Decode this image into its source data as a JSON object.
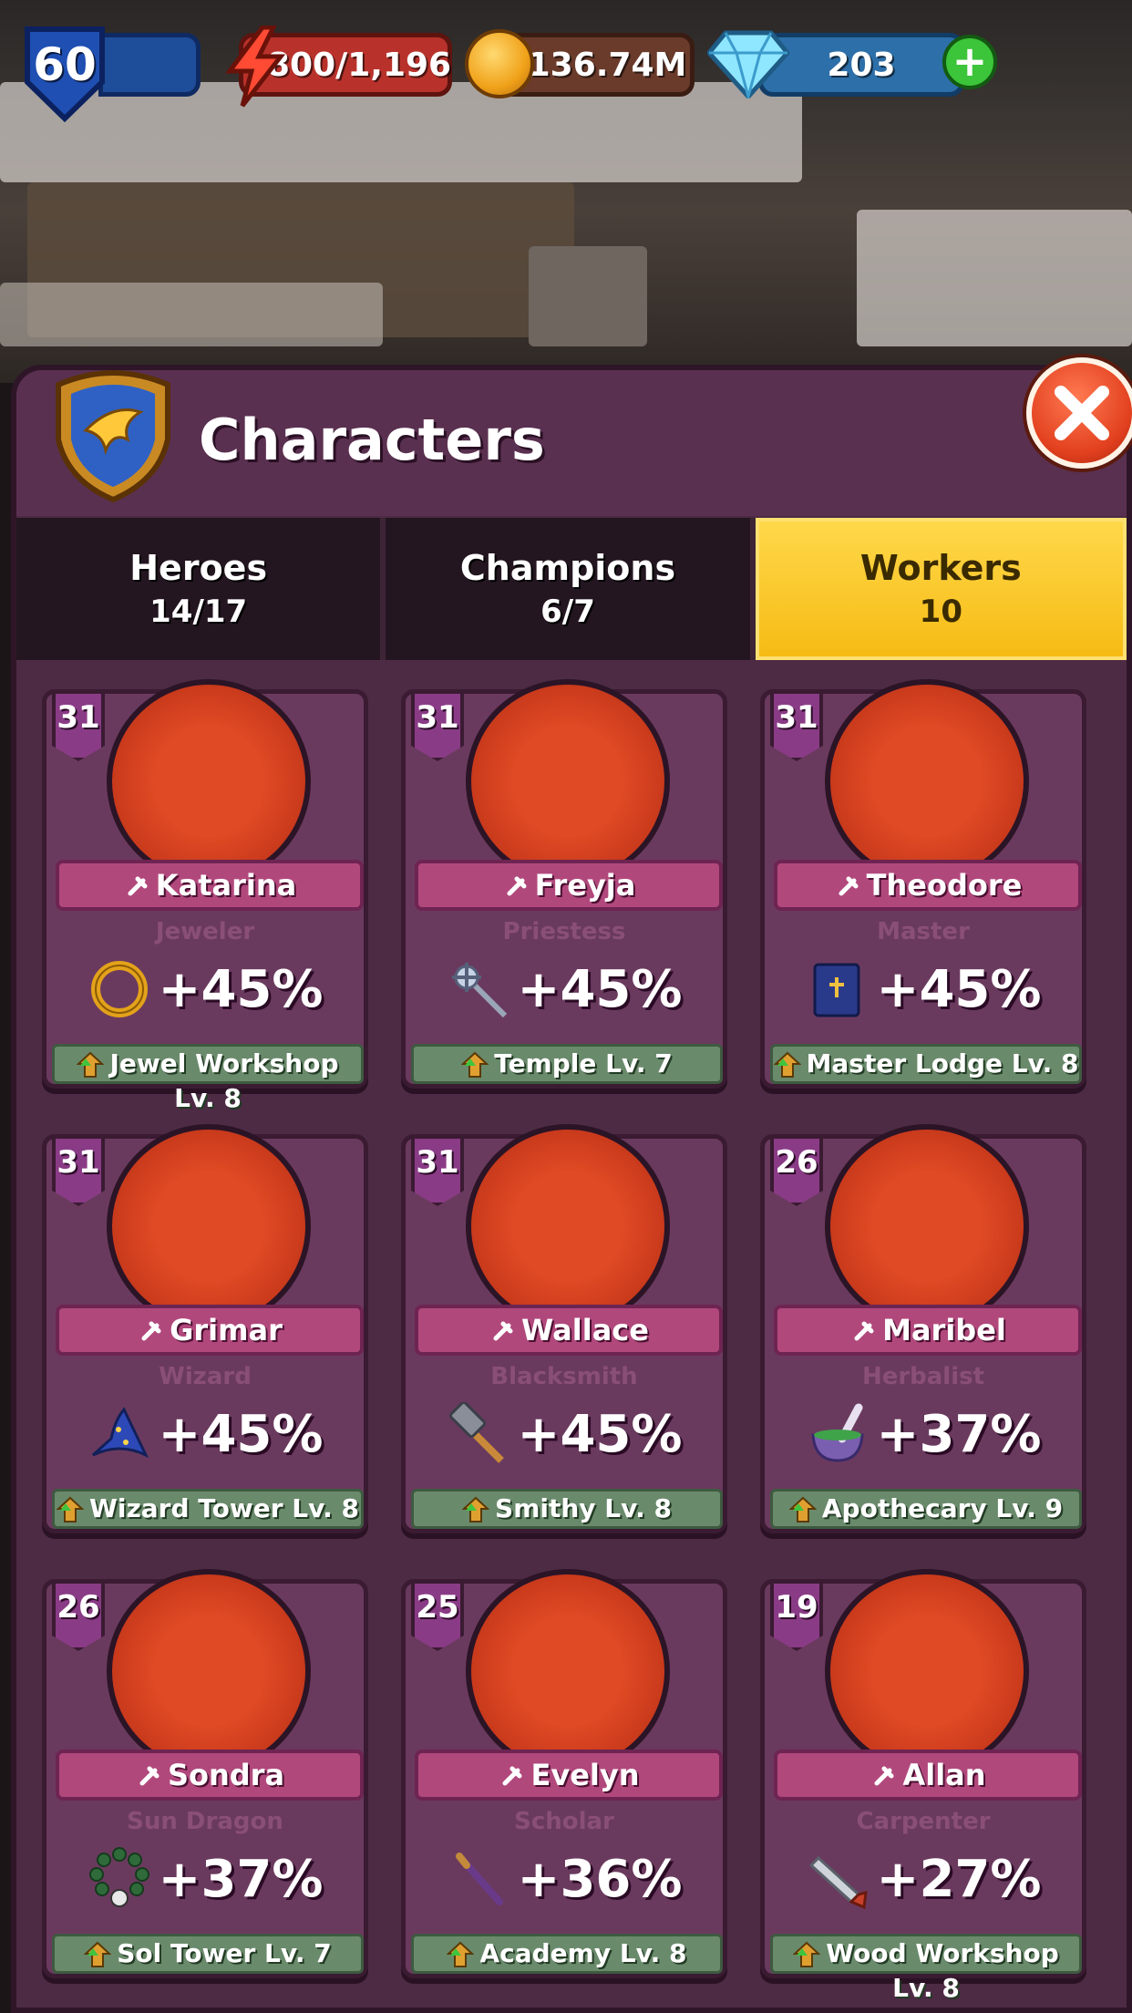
{
  "hud": {
    "level": "60",
    "energy": "800/1,196",
    "gold": "136.74M",
    "gems": "203"
  },
  "panel": {
    "title": "Characters"
  },
  "tabs": [
    {
      "label": "Heroes",
      "count": "14/17",
      "active": false
    },
    {
      "label": "Champions",
      "count": "6/7",
      "active": false
    },
    {
      "label": "Workers",
      "count": "10",
      "active": true
    }
  ],
  "workers": [
    {
      "level": "31",
      "name": "Katarina",
      "role": "Jeweler",
      "bonus": "+45%",
      "building": "Jewel Workshop Lv. 8",
      "icon": "ring-icon"
    },
    {
      "level": "31",
      "name": "Freyja",
      "role": "Priestess",
      "bonus": "+45%",
      "building": "Temple Lv. 7",
      "icon": "holy-staff-icon"
    },
    {
      "level": "31",
      "name": "Theodore",
      "role": "Master",
      "bonus": "+45%",
      "building": "Master Lodge Lv. 8",
      "icon": "book-icon"
    },
    {
      "level": "31",
      "name": "Grimar",
      "role": "Wizard",
      "bonus": "+45%",
      "building": "Wizard Tower Lv. 8",
      "icon": "wizard-hat-icon"
    },
    {
      "level": "31",
      "name": "Wallace",
      "role": "Blacksmith",
      "bonus": "+45%",
      "building": "Smithy Lv. 8",
      "icon": "hammer-icon"
    },
    {
      "level": "26",
      "name": "Maribel",
      "role": "Herbalist",
      "bonus": "+37%",
      "building": "Apothecary Lv. 9",
      "icon": "mortar-icon"
    },
    {
      "level": "26",
      "name": "Sondra",
      "role": "Sun Dragon",
      "bonus": "+37%",
      "building": "Sol Tower Lv. 7",
      "icon": "beads-icon"
    },
    {
      "level": "25",
      "name": "Evelyn",
      "role": "Scholar",
      "bonus": "+36%",
      "building": "Academy Lv. 8",
      "icon": "wand-icon"
    },
    {
      "level": "19",
      "name": "Allan",
      "role": "Carpenter",
      "bonus": "+27%",
      "building": "Wood Workshop Lv. 8",
      "icon": "saw-icon"
    }
  ],
  "colors": {
    "panel": "#4d2b44",
    "active_tab": "#f6bb14",
    "ribbon": "#b1487c",
    "building_bar": "#6a8a6c"
  }
}
